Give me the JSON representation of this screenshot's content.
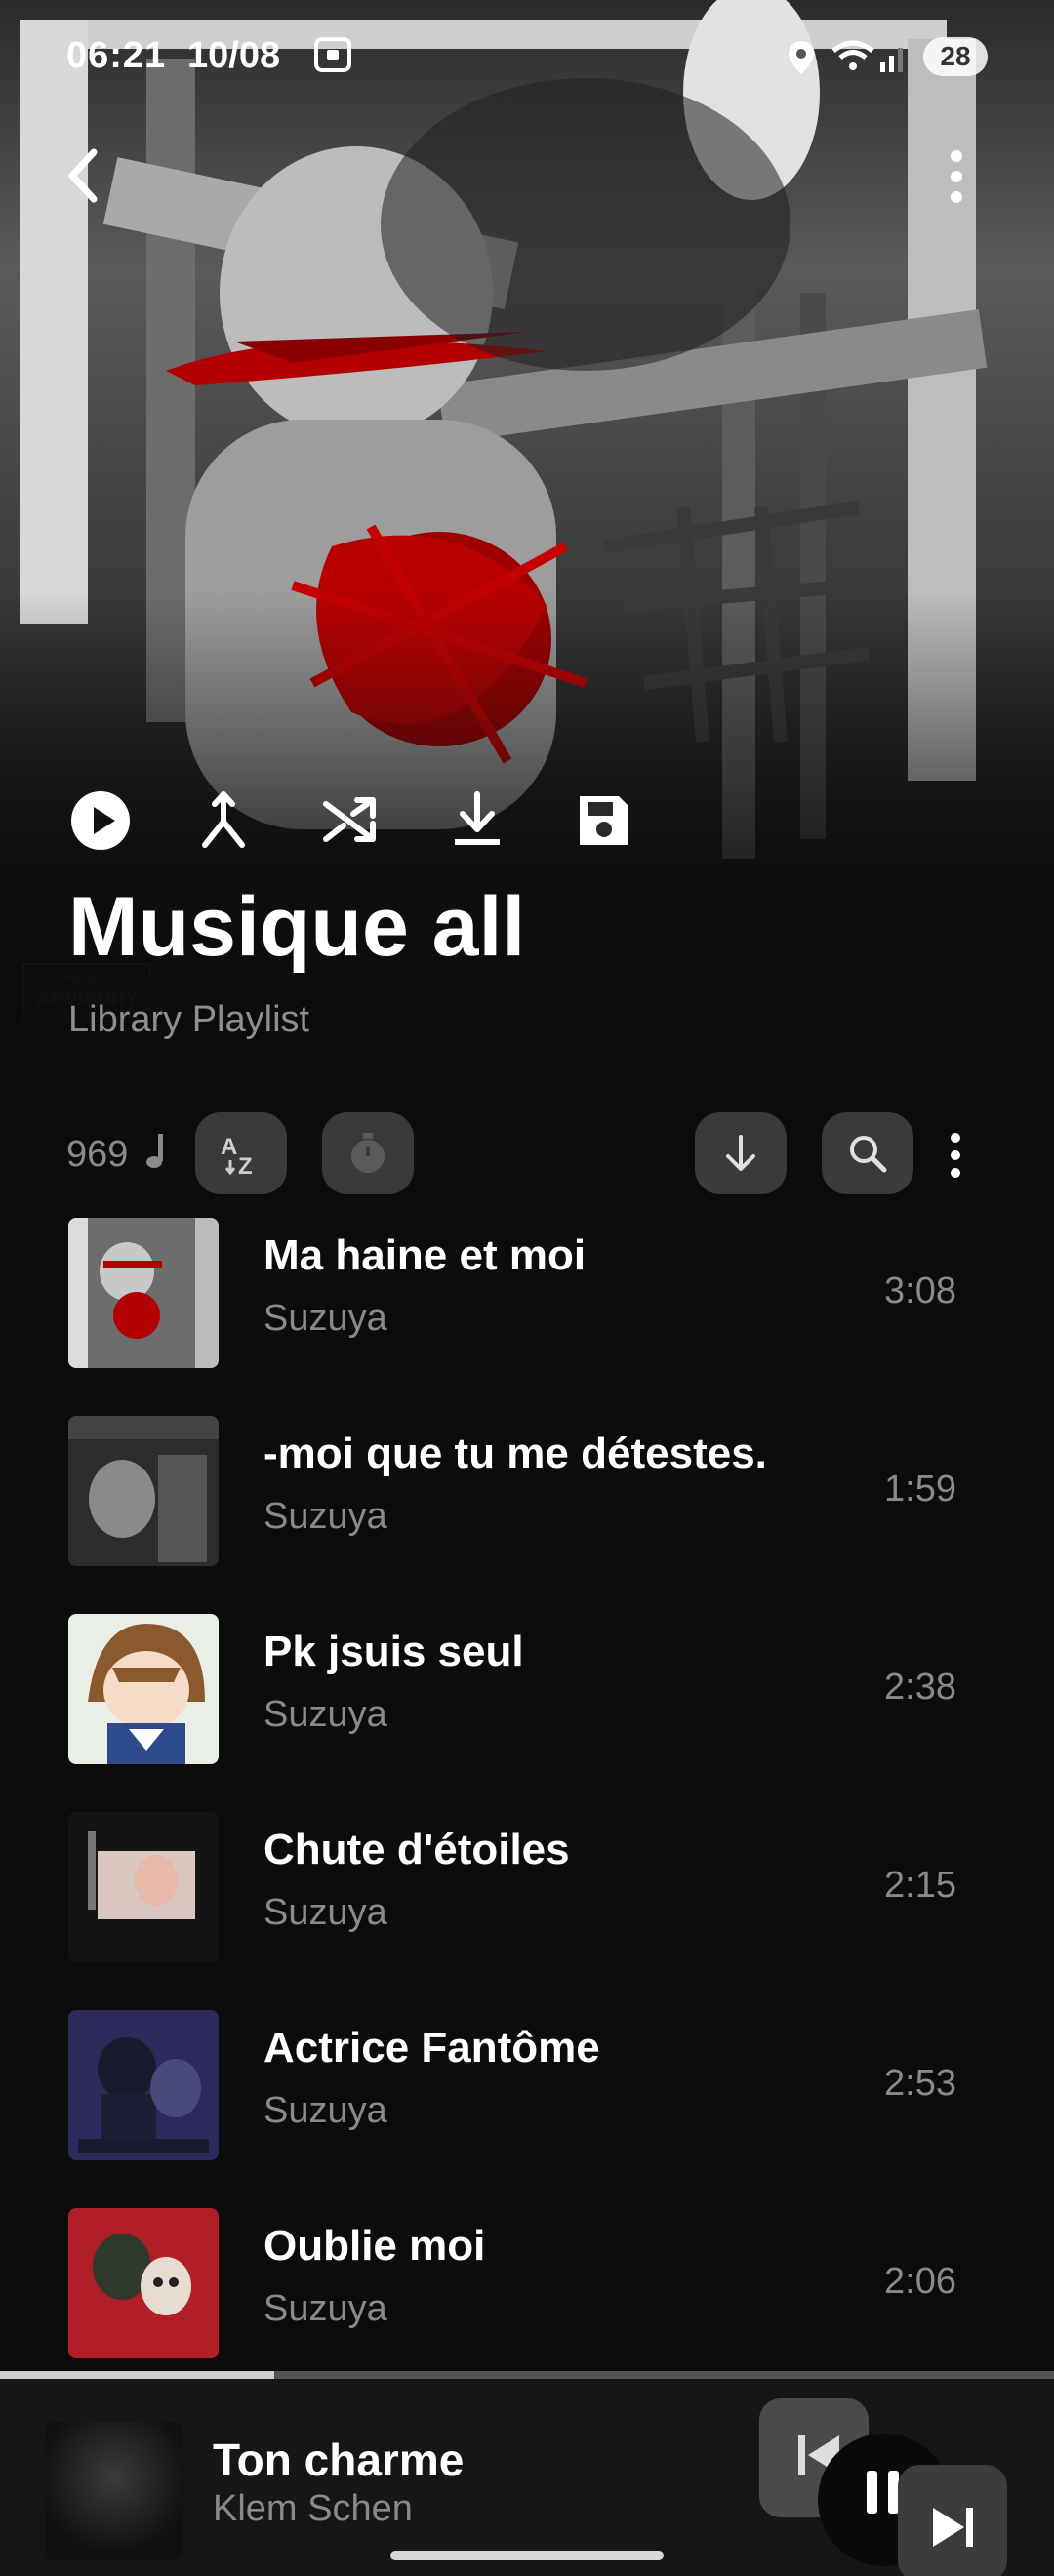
{
  "status_bar": {
    "time": "06:21",
    "date": "10/08",
    "battery": "28"
  },
  "icons": {
    "back": "chevron-left-icon",
    "more": "more-vertical-icon",
    "play": "play-circle-icon",
    "merge": "merge-icon",
    "shuffle": "shuffle-icon",
    "download": "download-icon",
    "save": "save-icon",
    "sort": "sort-az-icon",
    "timer": "timer-icon",
    "sort_direction": "arrow-down-icon",
    "search": "search-icon"
  },
  "playlist": {
    "title": "Musique all",
    "subtitle": "Library Playlist",
    "track_count": "969"
  },
  "tracks": [
    {
      "title": "Ma haine et moi",
      "artist": "Suzuya",
      "duration": "3:08"
    },
    {
      "title": "-moi que tu me détestes.",
      "artist": "Suzuya",
      "duration": "1:59"
    },
    {
      "title": "Pk jsuis seul",
      "artist": "Suzuya",
      "duration": "2:38"
    },
    {
      "title": "Chute d'étoiles",
      "artist": "Suzuya",
      "duration": "2:15"
    },
    {
      "title": "Actrice Fantôme",
      "artist": "Suzuya",
      "duration": "2:53"
    },
    {
      "title": "Oublie moi",
      "artist": "Suzuya",
      "duration": "2:06"
    }
  ],
  "now_playing": {
    "title": "Ton charme",
    "artist": "Klem Schen",
    "progress": 0.26
  },
  "colors": {
    "background": "#0c0c0c",
    "muted_text": "#8a8a8a",
    "pill": "#3a3a3a",
    "accent_red": "#b30000"
  }
}
